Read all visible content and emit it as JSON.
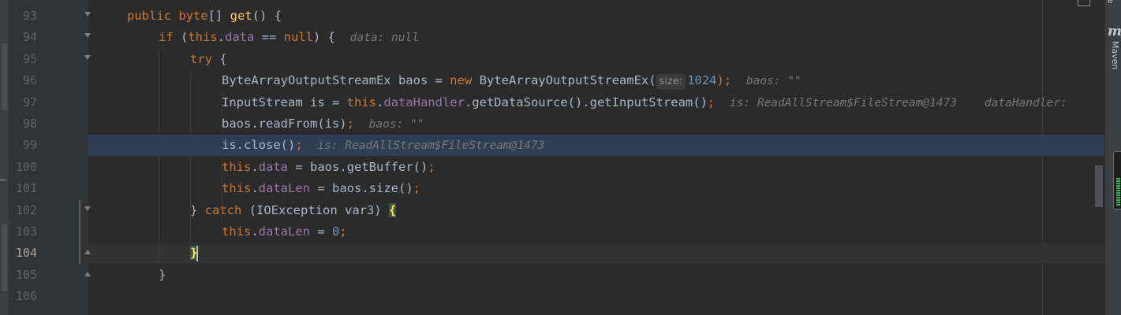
{
  "editor": {
    "lines": [
      {
        "num": "93",
        "indent": 0,
        "parts": [
          {
            "t": "public ",
            "c": "kw"
          },
          {
            "t": "byte",
            "c": "kw"
          },
          {
            "t": "[] ",
            "c": ""
          },
          {
            "t": "get",
            "c": "fn"
          },
          {
            "t": "() {",
            "c": ""
          }
        ],
        "fold": "tri"
      },
      {
        "num": "94",
        "indent": 1,
        "parts": [
          {
            "t": "if ",
            "c": "kw"
          },
          {
            "t": "(",
            "c": ""
          },
          {
            "t": "this",
            "c": "kw"
          },
          {
            "t": ".",
            "c": ""
          },
          {
            "t": "data",
            "c": "fld"
          },
          {
            "t": " == ",
            "c": ""
          },
          {
            "t": "null",
            "c": "kw"
          },
          {
            "t": ") {  ",
            "c": ""
          },
          {
            "t": "data: null",
            "c": "hint"
          }
        ],
        "fold": "tri"
      },
      {
        "num": "95",
        "indent": 2,
        "parts": [
          {
            "t": "try ",
            "c": "kw"
          },
          {
            "t": "{",
            "c": ""
          }
        ],
        "fold": "tri"
      },
      {
        "num": "96",
        "indent": 3,
        "parts": [
          {
            "t": "ByteArrayOutputStreamEx baos = ",
            "c": ""
          },
          {
            "t": "new ",
            "c": "kw"
          },
          {
            "t": "ByteArrayOutputStreamEx(",
            "c": ""
          },
          {
            "t": "size:",
            "c": "param"
          },
          {
            "t": "1024",
            "c": "num"
          },
          {
            "t": ");  ",
            "c": "kw"
          },
          {
            "t": "baos: \"\"",
            "c": "hint"
          }
        ]
      },
      {
        "num": "97",
        "indent": 3,
        "parts": [
          {
            "t": "InputStream is = ",
            "c": ""
          },
          {
            "t": "this",
            "c": "kw"
          },
          {
            "t": ".",
            "c": ""
          },
          {
            "t": "dataHandler",
            "c": "fld"
          },
          {
            "t": ".getDataSource().getInputStream()",
            "c": ""
          },
          {
            "t": ";  ",
            "c": "kw"
          },
          {
            "t": "is: ReadAllStream$FileStream@1473    dataHandler: ",
            "c": "hint"
          }
        ]
      },
      {
        "num": "98",
        "indent": 3,
        "parts": [
          {
            "t": "baos.readFrom(is)",
            "c": ""
          },
          {
            "t": ";  ",
            "c": "kw"
          },
          {
            "t": "baos: \"\"",
            "c": "hint"
          }
        ]
      },
      {
        "num": "99",
        "indent": 3,
        "parts": [
          {
            "t": "is.close()",
            "c": ""
          },
          {
            "t": ";  ",
            "c": "kw"
          },
          {
            "t": "is: ReadAllStream$FileStream@1473",
            "c": "hint"
          }
        ],
        "state": "exec"
      },
      {
        "num": "100",
        "indent": 3,
        "parts": [
          {
            "t": "this",
            "c": "kw"
          },
          {
            "t": ".",
            "c": ""
          },
          {
            "t": "data",
            "c": "fld"
          },
          {
            "t": " = baos.getBuffer()",
            "c": ""
          },
          {
            "t": ";",
            "c": "kw"
          }
        ]
      },
      {
        "num": "101",
        "indent": 3,
        "parts": [
          {
            "t": "this",
            "c": "kw"
          },
          {
            "t": ".",
            "c": ""
          },
          {
            "t": "dataLen",
            "c": "fld"
          },
          {
            "t": " = baos.size()",
            "c": ""
          },
          {
            "t": ";",
            "c": "kw"
          }
        ]
      },
      {
        "num": "102",
        "indent": 2,
        "parts": [
          {
            "t": "} ",
            "c": ""
          },
          {
            "t": "catch ",
            "c": "kw"
          },
          {
            "t": "(IOException var3) ",
            "c": ""
          },
          {
            "t": "{",
            "c": "brace"
          }
        ],
        "fold": "tri"
      },
      {
        "num": "103",
        "indent": 3,
        "parts": [
          {
            "t": "this",
            "c": "kw"
          },
          {
            "t": ".",
            "c": ""
          },
          {
            "t": "dataLen",
            "c": "fld"
          },
          {
            "t": " = ",
            "c": ""
          },
          {
            "t": "0",
            "c": "num"
          },
          {
            "t": ";",
            "c": "kw"
          }
        ]
      },
      {
        "num": "104",
        "indent": 2,
        "parts": [
          {
            "t": "}",
            "c": "brace"
          },
          {
            "t": "",
            "c": "caret"
          }
        ],
        "fold": "end",
        "state": "current"
      },
      {
        "num": "105",
        "indent": 1,
        "parts": [
          {
            "t": "}",
            "c": ""
          }
        ],
        "fold": "end"
      },
      {
        "num": "106",
        "indent": 0,
        "parts": []
      }
    ]
  },
  "right_panel": {
    "maven_icon": "m",
    "maven_label": "Maven",
    "top_letter": "e"
  },
  "memory_indicator": {
    "used_fraction": 0.55
  },
  "colors": {
    "background": "#2b2b2b",
    "keyword": "#cc7832",
    "function": "#ffc66d",
    "field": "#9876aa",
    "number": "#6897bb",
    "execution_line": "#2d3e55"
  }
}
